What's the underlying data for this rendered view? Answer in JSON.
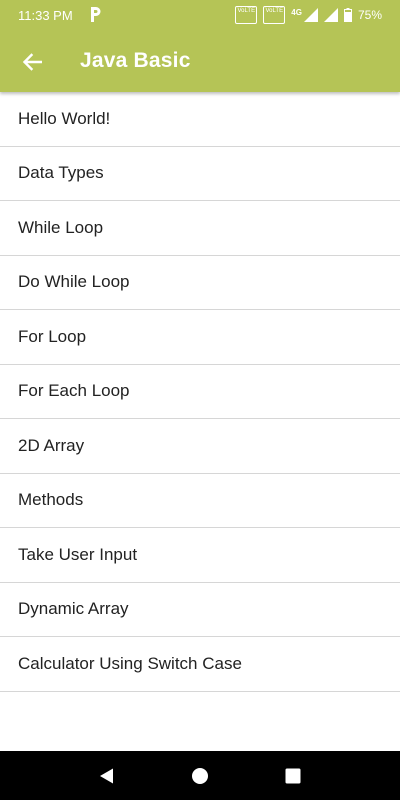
{
  "status_bar": {
    "time": "11:33 PM",
    "volte1": "VoLTE",
    "volte2": "VoLTE",
    "network": "4G",
    "battery": "75%"
  },
  "toolbar": {
    "title": "Java Basic",
    "back_icon": "arrow-left-icon"
  },
  "colors": {
    "appbar": "#b5c456",
    "navbar": "#000000"
  },
  "list": {
    "items": [
      {
        "label": "Hello World!"
      },
      {
        "label": "Data Types"
      },
      {
        "label": "While Loop"
      },
      {
        "label": "Do While Loop"
      },
      {
        "label": "For Loop"
      },
      {
        "label": "For Each Loop"
      },
      {
        "label": "2D Array"
      },
      {
        "label": "Methods"
      },
      {
        "label": "Take User Input"
      },
      {
        "label": "Dynamic Array"
      },
      {
        "label": "Calculator Using Switch Case"
      }
    ]
  },
  "navigation_bar": {
    "icons": [
      "back-triangle-icon",
      "home-circle-icon",
      "recents-square-icon"
    ]
  }
}
